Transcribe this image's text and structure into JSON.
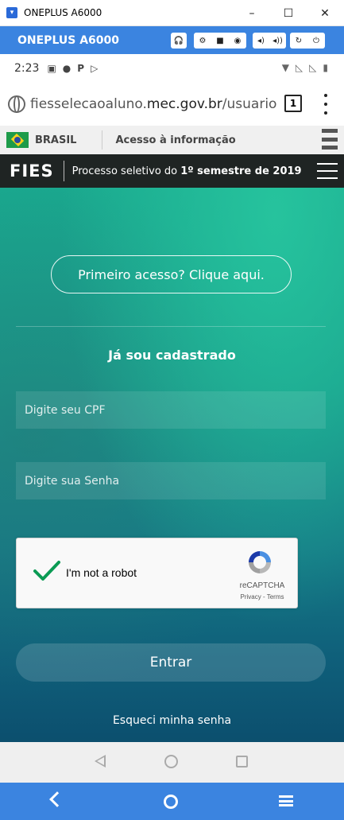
{
  "window": {
    "title": "ONEPLUS A6000",
    "minimize": "–",
    "maximize": "☐",
    "close": "✕"
  },
  "device_bar": {
    "name": "ONEPLUS A6000",
    "buttons": [
      "headset-icon",
      "settings-icon",
      "video-icon",
      "camera-icon",
      "volume-down-icon",
      "volume-up-icon",
      "rotate-icon",
      "power-icon"
    ]
  },
  "status_bar": {
    "time": "2:23",
    "left_icons": [
      "gallery-icon",
      "sync-icon",
      "p-icon",
      "play-store-icon"
    ],
    "right_icons": [
      "wifi-icon",
      "no-signal-icon",
      "no-signal-icon",
      "battery-icon"
    ]
  },
  "browser": {
    "url_prefix": "fiesselecaoaluno.",
    "url_domain": "mec.gov.br",
    "url_path": "/usuario-logi",
    "tab_count": "1"
  },
  "gov_bar": {
    "brasil": "BRASIL",
    "acesso": "Acesso à informação"
  },
  "fies_header": {
    "logo": "FIES",
    "process_prefix": "Processo seletivo do ",
    "process_bold": "1º semestre de 2019"
  },
  "hero": {
    "first_access": "Primeiro acesso? Clique aqui.",
    "heading": "Já sou cadastrado",
    "cpf_placeholder": "Digite seu CPF",
    "password_placeholder": "Digite sua Senha",
    "submit": "Entrar",
    "forgot": "Esqueci minha senha"
  },
  "recaptcha": {
    "label": "I'm not a robot",
    "brand": "reCAPTCHA",
    "links": "Privacy - Terms",
    "checked": true
  },
  "colors": {
    "device_bar": "#3b84e0",
    "fies_header": "#1f2423",
    "hero_top": "#1aa88e",
    "hero_bottom": "#0c4f6e",
    "check_green": "#0b9b54"
  }
}
